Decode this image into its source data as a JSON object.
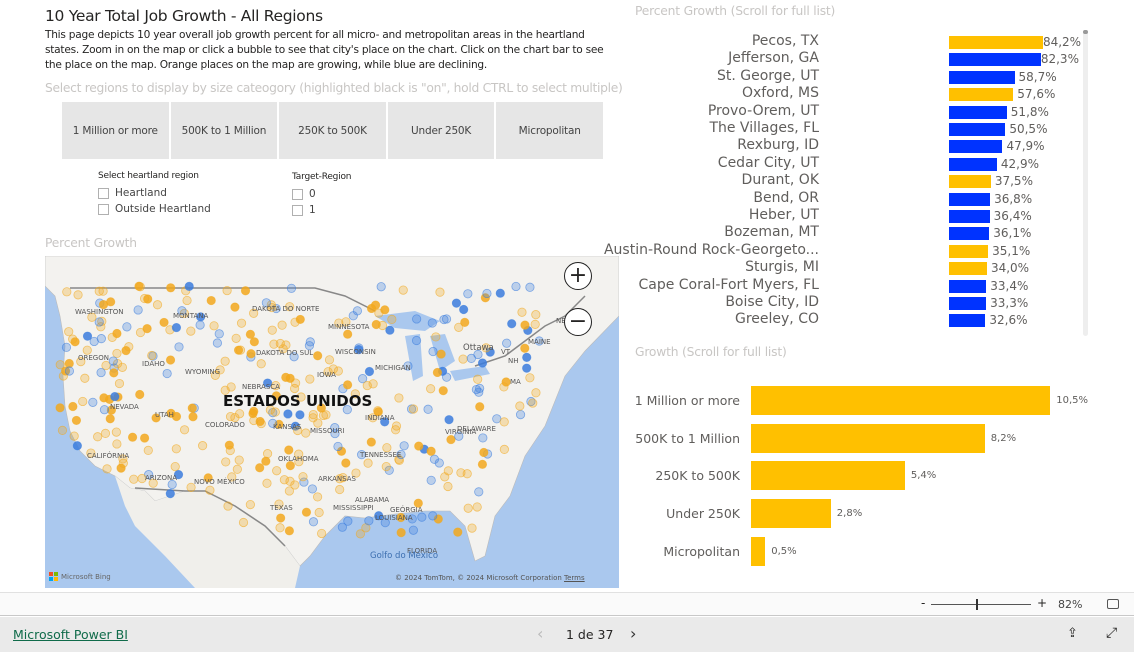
{
  "title": "10 Year Total Job Growth - All Regions",
  "description": "This page depicts 10 year overall job growth percent for all micro- and metropolitan areas in the heartland states. Zoom in on the map or click a bubble to see that city's place on the chart. Click on the chart bar to see the place on the map. Orange places on the map are growing, while blue are declining.",
  "size_slicer": {
    "title": "Select regions to display by size cateogory (highlighted black is \"on\", hold CTRL to select multiple)",
    "options": [
      "1 Million or more",
      "500K to 1 Million",
      "250K to 500K",
      "Under 250K",
      "Micropolitan"
    ]
  },
  "heartland_slicer": {
    "title": "Select heartland region",
    "options": [
      "Heartland",
      "Outside Heartland"
    ]
  },
  "target_slicer": {
    "title": "Target-Region",
    "options": [
      "0",
      "1"
    ]
  },
  "map": {
    "title": "Percent Growth",
    "country_label": "ESTADOS UNIDOS",
    "labels": [
      "WASHINGTON",
      "MONTANA",
      "DAKOTA DO NORTE",
      "MINNESOTA",
      "OREGON",
      "IDAHO",
      "WYOMING",
      "DAKOTA DO SUL",
      "WISCONSIN",
      "MICHIGAN",
      "IOWA",
      "NEBRASCA",
      "NEVADA",
      "UTAH",
      "COLORADO",
      "KANSAS",
      "MISSOURI",
      "INDIANA",
      "CALIFÓRNIA",
      "OKLAHOMA",
      "ARIZONA",
      "NOVO MÉXICO",
      "ARKANSAS",
      "TENNESSEE",
      "ALABAMA",
      "TEXAS",
      "MISSISSIPPI",
      "LOUISIANA",
      "GEÓRGIA",
      "FLORIDA",
      "Ottawa",
      "MAINE",
      "NB",
      "VT",
      "NH",
      "MA",
      "DELAWARE",
      "VIRGÍNIA",
      "Golfo do México"
    ],
    "zoom_in": "+",
    "zoom_out": "−",
    "attribution": "© 2024 TomTom, © 2024 Microsoft Corporation",
    "terms": "Terms",
    "bing_logo": "Microsoft Bing",
    "colors": {
      "growing": "#f2a81d",
      "declining": "#3b7ddd"
    }
  },
  "chart_data": [
    {
      "type": "bar",
      "orientation": "horizontal",
      "title": "Percent Growth  (Scroll for full list)",
      "categories": [
        "Pecos, TX",
        "Jefferson, GA",
        "St. George, UT",
        "Oxford, MS",
        "Provo-Orem, UT",
        "The Villages, FL",
        "Rexburg, ID",
        "Cedar City, UT",
        "Durant, OK",
        "Bend, OR",
        "Heber, UT",
        "Bozeman, MT",
        "Austin-Round Rock-Georgeto...",
        "Sturgis, MI",
        "Cape Coral-Fort Myers, FL",
        "Boise City, ID",
        "Greeley, CO"
      ],
      "values": [
        84.2,
        82.3,
        58.7,
        57.6,
        51.8,
        50.5,
        47.9,
        42.9,
        37.5,
        36.8,
        36.4,
        36.1,
        35.1,
        34.0,
        33.4,
        33.3,
        32.6
      ],
      "value_labels": [
        "84,2%",
        "82,3%",
        "58,7%",
        "57,6%",
        "51,8%",
        "50,5%",
        "47,9%",
        "42,9%",
        "37,5%",
        "36,8%",
        "36,4%",
        "36,1%",
        "35,1%",
        "34,0%",
        "33,4%",
        "33,3%",
        "32,6%"
      ],
      "colors": [
        "#ffc000",
        "#0033ff",
        "#0033ff",
        "#ffc000",
        "#0033ff",
        "#0033ff",
        "#0033ff",
        "#0033ff",
        "#ffc000",
        "#0033ff",
        "#0033ff",
        "#0033ff",
        "#ffc000",
        "#ffc000",
        "#0033ff",
        "#0033ff",
        "#0033ff"
      ]
    },
    {
      "type": "bar",
      "orientation": "horizontal",
      "title": "Growth (Scroll for full list)",
      "categories": [
        "1 Million or more",
        "500K to 1 Million",
        "250K to 500K",
        "Under 250K",
        "Micropolitan"
      ],
      "values": [
        10.5,
        8.2,
        5.4,
        2.8,
        0.5
      ],
      "value_labels": [
        "10,5%",
        "8,2%",
        "5,4%",
        "2,8%",
        "0,5%"
      ],
      "color": "#ffc000"
    }
  ],
  "statusbar": {
    "zoom_minus": "-",
    "zoom_plus": "+",
    "zoom_level": "82%",
    "zoom_fraction": 0.45
  },
  "footer": {
    "brand_link": "Microsoft Power BI",
    "page_indicator": "1 de 37",
    "prev": "‹",
    "next": "›"
  }
}
